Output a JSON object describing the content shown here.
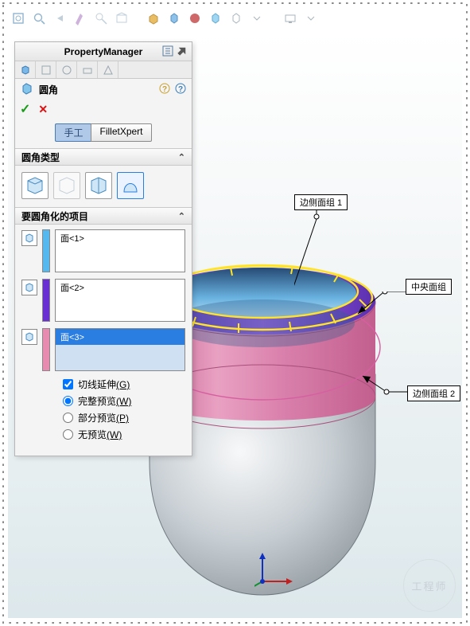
{
  "pm": {
    "title": "PropertyManager",
    "feature_label": "圆角",
    "mode_manual": "手工",
    "mode_xpert": "FilletXpert"
  },
  "sections": {
    "type_label": "圆角类型",
    "items_label": "要圆角化的项目"
  },
  "faces": {
    "f1": "面<1>",
    "f2": "面<2>",
    "f3": "面<3>"
  },
  "colors": {
    "swatch1": "#55b9ef",
    "swatch2": "#6a2fd3",
    "swatch3": "#e88bb1"
  },
  "opts": {
    "tangent": "切线延伸",
    "tangent_key": "(G)",
    "full": "完整预览",
    "full_key": "(W)",
    "partial": "部分预览",
    "partial_key": "(P)",
    "none": "无预览",
    "none_key": "(W)"
  },
  "annotations": {
    "top": "边侧面组 1",
    "mid": "中央面组",
    "bottom": "边侧面组 2"
  },
  "watermark": "工程师"
}
